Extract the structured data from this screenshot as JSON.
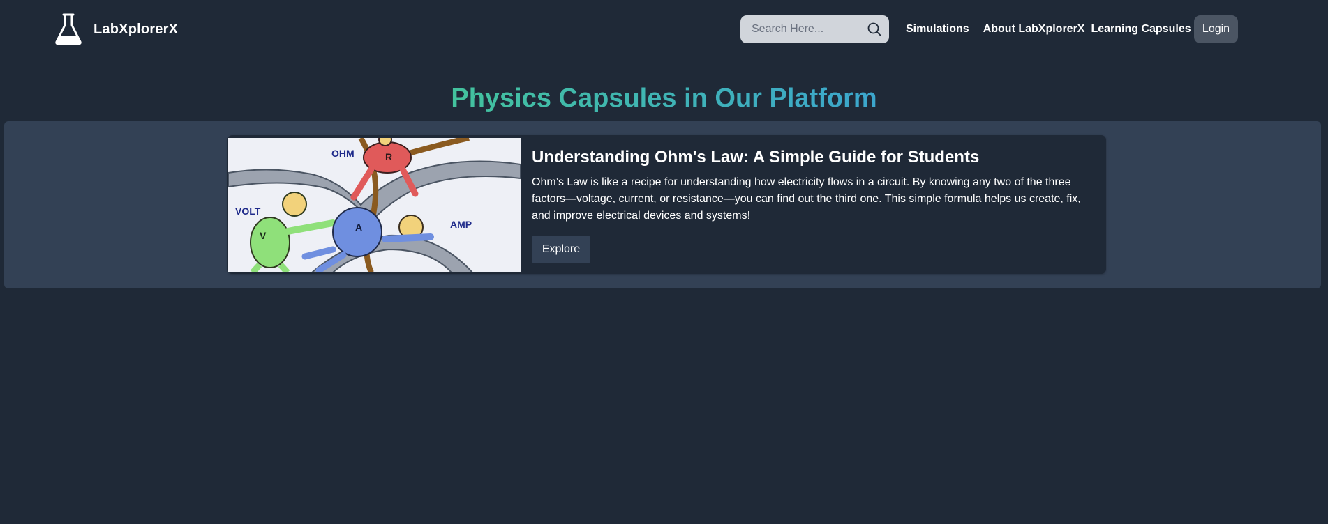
{
  "brand": {
    "name": "LabXplorerX",
    "logo_icon": "flask-icon"
  },
  "search": {
    "placeholder": "Search Here...",
    "value": "",
    "icon": "search-icon"
  },
  "nav": {
    "items": [
      {
        "label": "Simulations"
      },
      {
        "label": "About LabXplorerX"
      },
      {
        "label": "Learning Capsules"
      }
    ],
    "login_label": "Login"
  },
  "page": {
    "title": "Physics Capsules in Our Platform"
  },
  "capsules": [
    {
      "title": "Understanding Ohm's Law: A Simple Guide for Students",
      "description": "Ohm’s Law is like a recipe for understanding how electricity flows in a circuit. By knowing any two of the three factors—voltage, current, or resistance—you can find out the third one. This simple formula helps us create, fix, and improve electrical devices and systems!",
      "button_label": "Explore",
      "image": {
        "labels": {
          "ohm": "OHM",
          "volt": "VOLT",
          "amp": "AMP",
          "r": "R",
          "v": "V",
          "a": "A"
        }
      }
    }
  ],
  "colors": {
    "background": "#1f2937",
    "panel": "#334155",
    "search_bg": "#d1d5db",
    "login_bg": "#4b5563",
    "title_gradient_start": "#43c29d",
    "title_gradient_end": "#3ca6cd"
  }
}
